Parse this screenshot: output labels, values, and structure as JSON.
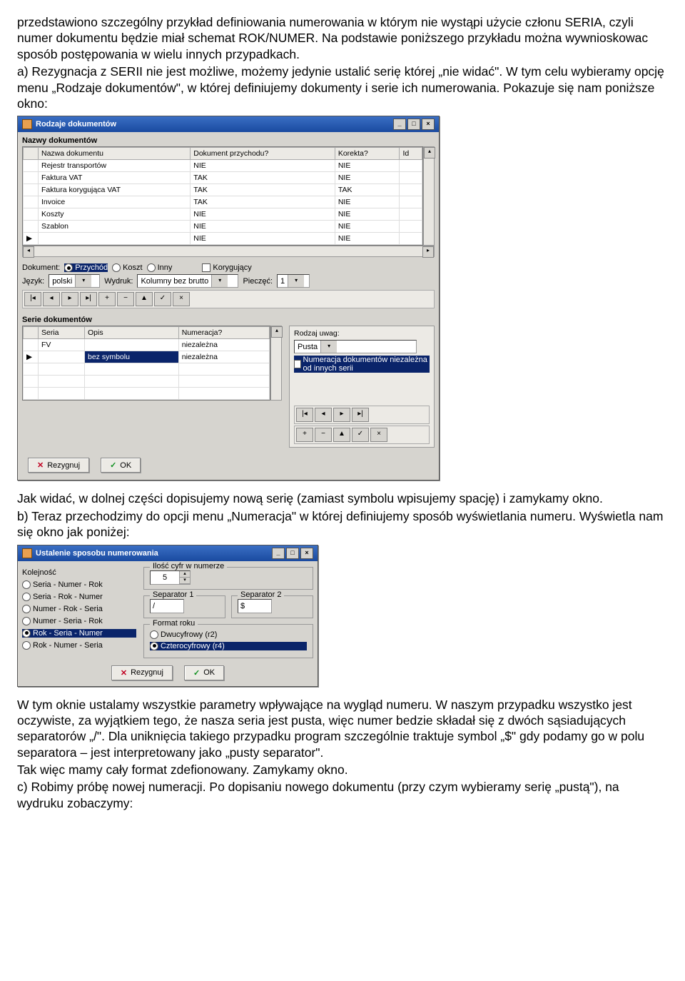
{
  "para1": "przedstawiono szczególny przykład definiowania numerowania w którym nie wystąpi użycie członu SERIA, czyli numer dokumentu będzie miał schemat ROK/NUMER. Na podstawie poniższego przykładu można wywnioskowac sposób postępowania w wielu innych przypadkach.",
  "para2": "a) Rezygnacja z SERII nie jest możliwe, możemy jedynie ustalić serię której „nie widać\". W tym celu wybieramy opcję menu „Rodzaje dokumentów\", w której definiujemy dokumenty i serie ich numerowania. Pokazuje się nam poniższe okno:",
  "win1": {
    "title": "Rodzaje dokumentów",
    "group1": "Nazwy dokumentów",
    "cols": [
      "Nazwa dokumentu",
      "Dokument przychodu?",
      "Korekta?",
      "Id"
    ],
    "rows": [
      [
        "Rejestr transportów",
        "NIE",
        "NIE",
        ""
      ],
      [
        "Faktura VAT",
        "TAK",
        "NIE",
        ""
      ],
      [
        "Faktura korygująca VAT",
        "TAK",
        "TAK",
        ""
      ],
      [
        "Invoice",
        "TAK",
        "NIE",
        ""
      ],
      [
        "Koszty",
        "NIE",
        "NIE",
        ""
      ],
      [
        "Szablon",
        "NIE",
        "NIE",
        ""
      ],
      [
        "",
        "NIE",
        "NIE",
        ""
      ]
    ],
    "form": {
      "dokument": "Dokument:",
      "r1": "Przychód",
      "r2": "Koszt",
      "r3": "Inny",
      "chk": "Korygujący",
      "jezyk": "Język:",
      "jezyk_val": "polski",
      "wydruk": "Wydruk:",
      "wydruk_val": "Kolumny bez brutto",
      "pieczec": "Pieczęć:",
      "pieczec_val": "1"
    },
    "group2": "Serie dokumentów",
    "cols2": [
      "Seria",
      "Opis",
      "Numeracja?"
    ],
    "rows2": [
      [
        "FV",
        "",
        "niezależna"
      ],
      [
        "",
        "bez symbolu",
        "niezależna"
      ]
    ],
    "right_label": "Rodzaj uwag:",
    "right_val": "Pusta",
    "right_chk": "Numeracja dokumentów niezależna od innych serii",
    "btn_cancel": "Rezygnuj",
    "btn_ok": "OK"
  },
  "para3a": "Jak widać, w dolnej części dopisujemy nową serię (zamiast symbolu wpisujemy spację) i zamykamy okno.",
  "para3b": "b) Teraz przechodzimy do opcji menu „Numeracja\" w której definiujemy sposób wyświetlania numeru. Wyświetla nam się okno jak poniżej:",
  "win2": {
    "title": "Ustalenie sposobu numerowania",
    "left_label": "Kolejność",
    "opts": [
      "Seria - Numer - Rok",
      "Seria - Rok - Numer",
      "Numer - Rok - Seria",
      "Numer - Seria - Rok",
      "Rok - Seria - Numer",
      "Rok - Numer - Seria"
    ],
    "sel_idx": 4,
    "digits_label": "Ilość cyfr w numerze",
    "digits_val": "5",
    "sep1": "Separator 1",
    "sep1_val": "/",
    "sep2": "Separator 2",
    "sep2_val": "$",
    "year_label": "Format roku",
    "year_opts": [
      "Dwucyfrowy (r2)",
      "Czterocyfrowy (r4)"
    ],
    "year_sel": 1,
    "btn_cancel": "Rezygnuj",
    "btn_ok": "OK"
  },
  "para4": "W tym oknie ustalamy wszystkie parametry wpływające na wygląd numeru. W naszym przypadku wszystko jest oczywiste, za wyjątkiem tego, że nasza seria jest pusta, więc numer bedzie składał się z dwóch sąsiadujących separatorów „/\". Dla uniknięcia takiego przypadku program szczególnie traktuje symbol „$\" gdy podamy go w polu separatora – jest interpretowany jako „pusty separator\".",
  "para5": "Tak więc mamy cały format zdefionowany. Zamykamy okno.",
  "para6": "c) Robimy próbę nowej numeracji. Po dopisaniu nowego dokumentu (przy czym wybieramy serię „pustą\"), na wydruku zobaczymy:"
}
